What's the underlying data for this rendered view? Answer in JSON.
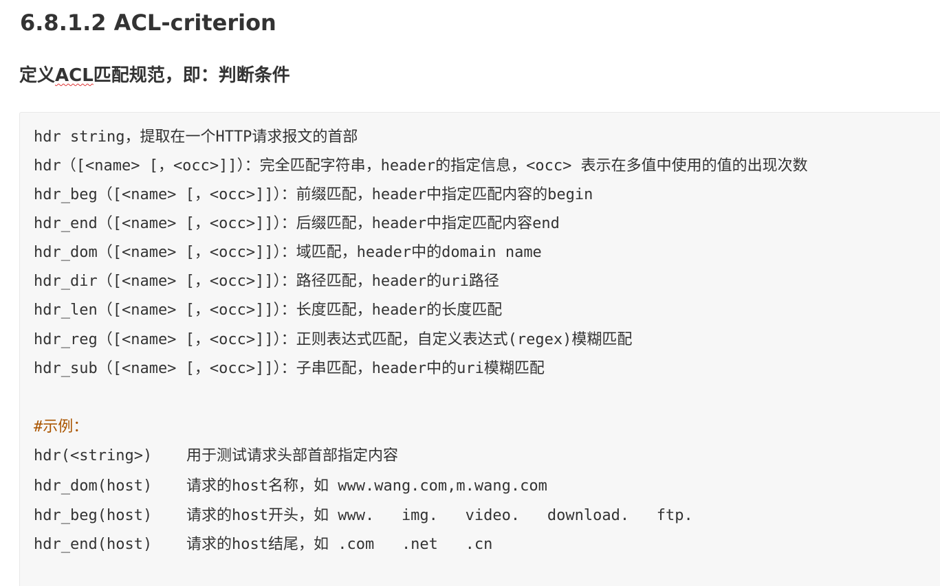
{
  "heading": "6.8.1.2 ACL-criterion",
  "subheading": {
    "before": "定义",
    "underlined": "ACL",
    "after": "匹配规范，即：判断条件"
  },
  "code": {
    "lines": [
      "hdr string，提取在一个HTTP请求报文的首部",
      "hdr（[<name> [，<occ>]]）：完全匹配字符串，header的指定信息，<occ> 表示在多值中使用的值的出现次数",
      "hdr_beg（[<name> [，<occ>]]）：前缀匹配，header中指定匹配内容的begin",
      "hdr_end（[<name> [，<occ>]]）：后缀匹配，header中指定匹配内容end",
      "hdr_dom（[<name> [，<occ>]]）：域匹配，header中的domain name",
      "hdr_dir（[<name> [，<occ>]]）：路径匹配，header的uri路径",
      "hdr_len（[<name> [，<occ>]]）：长度匹配，header的长度匹配",
      "hdr_reg（[<name> [，<occ>]]）：正则表达式匹配，自定义表达式(regex)模糊匹配",
      "hdr_sub（[<name> [，<occ>]]）：子串匹配，header中的uri模糊匹配"
    ],
    "example_comment": "#示例：",
    "examples": [
      {
        "func": "hdr(<string>)",
        "desc": "用于测试请求头部首部指定内容"
      },
      {
        "func": "hdr_dom(host)",
        "desc": "请求的host名称，如 www.wang.com,m.wang.com"
      },
      {
        "func": "hdr_beg(host)",
        "desc": "请求的host开头，如 www.   img.   video.   download.   ftp."
      },
      {
        "func": "hdr_end(host)",
        "desc": "请求的host结尾，如 .com   .net   .cn"
      }
    ]
  }
}
